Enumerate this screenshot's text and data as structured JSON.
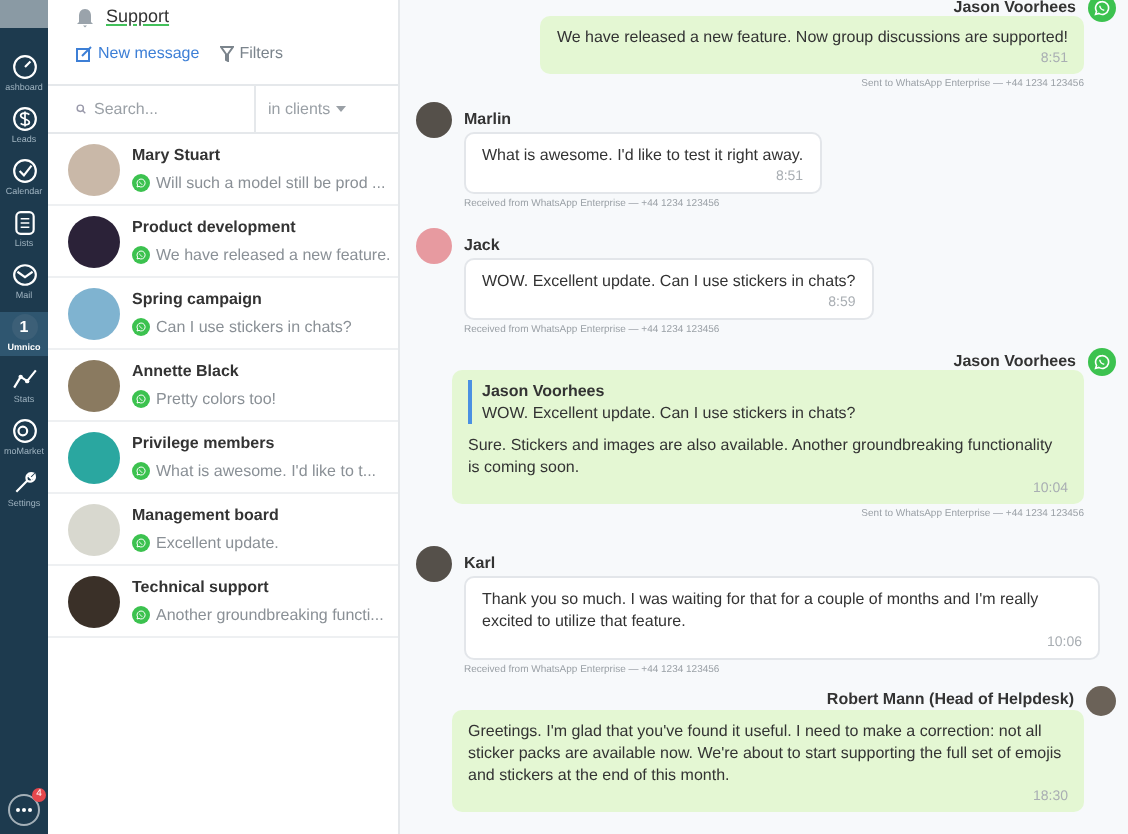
{
  "nav": [
    {
      "label": "ashboard",
      "selected": false
    },
    {
      "label": "Leads",
      "selected": false
    },
    {
      "label": "Calendar",
      "selected": false
    },
    {
      "label": "Lists",
      "selected": false
    },
    {
      "label": "Mail",
      "selected": false
    },
    {
      "label": "Umnico",
      "badge": "1",
      "selected": true
    },
    {
      "label": "Stats",
      "selected": false
    },
    {
      "label": "moMarket",
      "selected": false
    },
    {
      "label": "Settings",
      "selected": false
    }
  ],
  "chat_badge": "4",
  "header": {
    "title": "Support",
    "new_message": "New message",
    "filters": "Filters"
  },
  "search": {
    "placeholder": "Search...",
    "scope": "in clients"
  },
  "chats": [
    {
      "name": "Mary Stuart",
      "preview": "Will such a model still be prod ..."
    },
    {
      "name": "Product development",
      "preview": "We have released a new feature."
    },
    {
      "name": "Spring campaign",
      "preview": "Can I use stickers in chats?"
    },
    {
      "name": "Annette Black",
      "preview": "Pretty colors too!"
    },
    {
      "name": "Privilege members",
      "preview": "What is awesome. I'd like to t..."
    },
    {
      "name": "Management board",
      "preview": "Excellent update."
    },
    {
      "name": "Technical support",
      "preview": "Another groundbreaking functi..."
    }
  ],
  "messages": [
    {
      "kind": "outgoing",
      "sender": "Jason Voorhees",
      "via_whatsapp": true,
      "text": "We have released a new feature. Now group discussions are supported!",
      "time": "8:51",
      "footer": "Sent to WhatsApp Enterprise — +44 1234 123456"
    },
    {
      "kind": "incoming",
      "sender": "Marlin",
      "text": "What is awesome. I'd like to test it right away.",
      "time": "8:51",
      "footer": "Received from WhatsApp Enterprise — +44 1234 123456"
    },
    {
      "kind": "incoming",
      "sender": "Jack",
      "text": "WOW. Excellent update. Can I use stickers in chats?",
      "time": "8:59",
      "footer": "Received from WhatsApp Enterprise — +44 1234 123456"
    },
    {
      "kind": "outgoing",
      "sender": "Jason Voorhees",
      "via_whatsapp": true,
      "quote": {
        "sender": "Jason Voorhees",
        "text": "WOW. Excellent update. Can I use stickers in chats?"
      },
      "text": "Sure. Stickers and images are also available. Another groundbreaking functionality is coming soon.",
      "time": "10:04",
      "footer": "Sent to WhatsApp Enterprise — +44 1234 123456"
    },
    {
      "kind": "incoming",
      "sender": "Karl",
      "text": "Thank you so much. I was waiting for that for a couple of months and I'm really excited to utilize that feature.",
      "time": "10:06",
      "footer": "Received from WhatsApp Enterprise — +44 1234 123456"
    },
    {
      "kind": "outgoing",
      "sender": "Robert Mann (Head of Helpdesk)",
      "via_whatsapp": false,
      "text": "Greetings. I'm glad that you've found it useful. I need to make a correction: not all sticker packs are available now. We're about to start supporting the full set of emojis and stickers at the end of this month.",
      "time": "18:30"
    }
  ]
}
